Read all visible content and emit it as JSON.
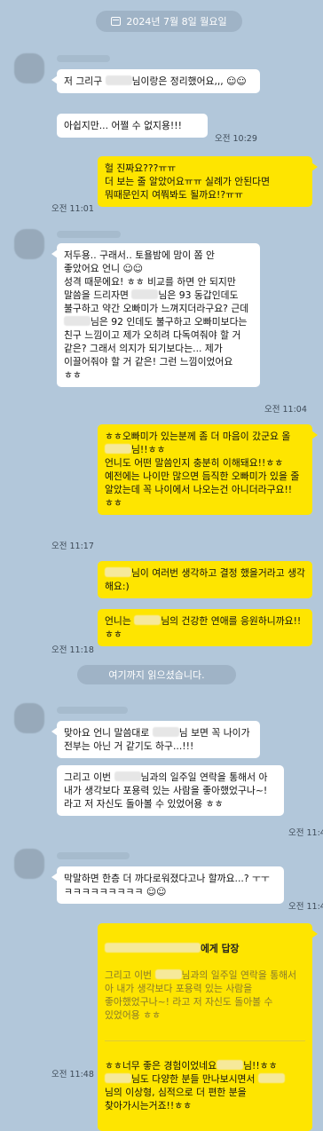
{
  "date_label": "2024년 7월 8일 월요일",
  "read_marker": "여기까지 읽으셨습니다.",
  "messages": {
    "m1a": "저 그리구 ",
    "m1b": "님이랑은 정리했어요,,, ☺☺",
    "m2": "아쉽지만... 어쩔 수 없지용!!!",
    "t1": "오전 10:29",
    "m3": "헐 진짜요???ㅠㅠ\n더 보는 줄 알았어요ㅠㅠ 실례가 안된다면 뭐때문인지 여쭤봐도 될까요!?ㅠㅠ",
    "t2": "오전 11:01",
    "m4a": "저두용.. 구래서.. 토욜밤에 맘이 쫌 안 좋았어요 언니 ☺☺\n성격 때문에요! ㅎㅎ 비교를 하면 안 되지만 말씀을 드리자면 ",
    "m4b": "님은 93 동갑인데도 불구하고 약간 오빠미가 느껴지더라구요? 근데 ",
    "m4c": "님은 92 인데도 불구하고 오빠미보다는 친구 느낌이고 제가 오히려 다독여줘야 할 거 같은? 그래서 의지가 되기보다는... 제가 이끌어줘야 할 거 같은! 그런 느낌이었어요 ㅎㅎ",
    "t3": "오전 11:04",
    "m5a": "ㅎㅎ오빠미가 있는분께 좀 더 마음이 갔군요 올 ",
    "m5b": "님!!ㅎㅎ\n언니도 어떤 말씀인지 충분히 이해돼요!!ㅎㅎ\n예전에는 나이만 많으면 듬직한 오빠미가 있을 줄 알았는데 꼭 나이에서 나오는건 아니더라구요!!ㅎㅎ",
    "t4": "오전 11:17",
    "m6": "님이 여러번 생각하고 결정 했을거라고 생각 해요:)",
    "m7a": "언니는 ",
    "m7b": "님의 건강한 연애를 응원하니까요!!ㅎㅎ",
    "t5": "오전 11:18",
    "m8a": "맞아요 언니 말씀대로 ",
    "m8b": "님 보면 꼭 나이가 전부는 아닌 거 같기도 하구...!!!",
    "m9a": "그리고 이번 ",
    "m9b": "님과의 일주일 연락을 통해서 아 내가 생각보다 포용력 있는 사람을 좋아했었구나~! 라고 저 자신도 돌아볼 수 있었어용 ㅎㅎ",
    "t6": "오전 11:41",
    "m10": "막말하면 한층 더 까다로워졌다고나 할까요...? ㅜㅜ ㅋㅋㅋㅋㅋㅋㅋㅋㅋ ☺☺",
    "t7": "오전 11:42",
    "reply_head": "에게 답장",
    "reply_quote_a": "그리고 이번 ",
    "reply_quote_b": "님과의 일주일 연락을 통해서 아 내가 생각보다 포용력 있는 사람을 좋아했었구나~! 라고 저 자신도 돌아볼 수 있었어용 ㅎㅎ",
    "m11a": "ㅎㅎ너무 좋은 경험이었네요",
    "m11b": "님!!ㅎㅎ\n",
    "m11c": "님도 다양한 분들 만나보시면서 ",
    "m11d": " 님의 이상형, 심적으로 더 편한 분을 찾아가시는거죠!!ㅎㅎ",
    "t8": "오전 11:48"
  }
}
